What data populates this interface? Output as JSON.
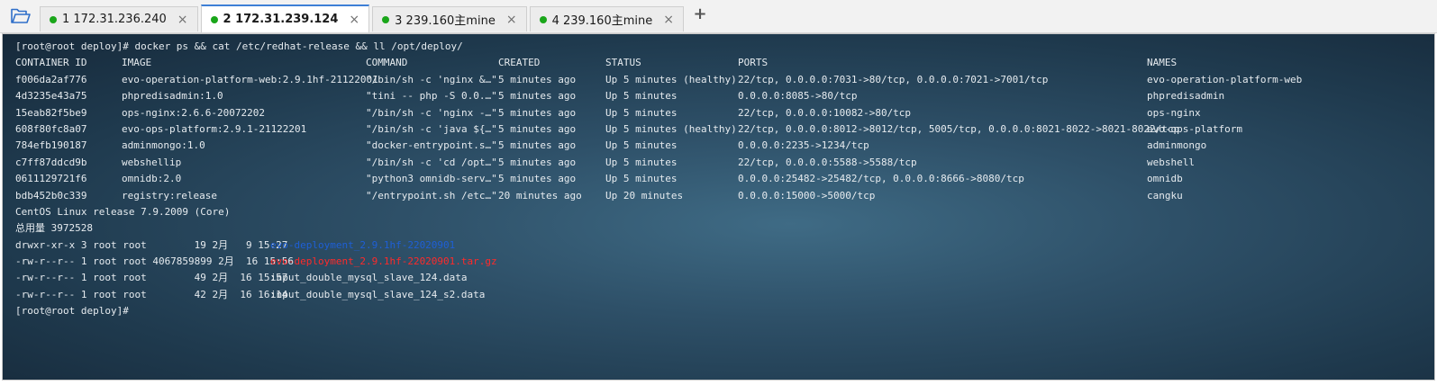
{
  "tabs": [
    {
      "label": "1 172.31.236.240",
      "active": false,
      "dot_color": "#1aa61a"
    },
    {
      "label": "2 172.31.239.124",
      "active": true,
      "dot_color": "#1aa61a"
    },
    {
      "label": "3 239.160主mine",
      "active": false,
      "dot_color": "#1aa61a"
    },
    {
      "label": "4 239.160主mine",
      "active": false,
      "dot_color": "#1aa61a"
    }
  ],
  "tab_close_glyph": "×",
  "add_tab_glyph": "+",
  "icons": {
    "folder": "folder-open-icon",
    "close": "close-icon",
    "add": "plus-icon"
  },
  "colors": {
    "accent": "#3d7fd6",
    "terminal_text": "#e6ebef",
    "dir_color": "#1e5fd6",
    "archive_color": "#ff2a2a"
  },
  "terminal": {
    "command": "[root@root deploy]# docker ps && cat /etc/redhat-release && ll /opt/deploy/",
    "headers": {
      "id": "CONTAINER ID",
      "image": "IMAGE",
      "command": "COMMAND",
      "created": "CREATED",
      "status": "STATUS",
      "ports": "PORTS",
      "names": "NAMES"
    },
    "containers": [
      {
        "id": "f006da2af776",
        "image": "evo-operation-platform-web:2.9.1hf-21122001",
        "command": "\"/bin/sh -c 'nginx &…\"",
        "created": "5 minutes ago",
        "status": "Up 5 minutes (healthy)",
        "ports": "22/tcp, 0.0.0.0:7031->80/tcp, 0.0.0.0:7021->7001/tcp",
        "names": "evo-operation-platform-web"
      },
      {
        "id": "4d3235e43a75",
        "image": "phpredisadmin:1.0",
        "command": "\"tini -- php -S 0.0.…\"",
        "created": "5 minutes ago",
        "status": "Up 5 minutes",
        "ports": "0.0.0.0:8085->80/tcp",
        "names": "phpredisadmin"
      },
      {
        "id": "15eab82f5be9",
        "image": "ops-nginx:2.6.6-20072202",
        "command": "\"/bin/sh -c 'nginx -…\"",
        "created": "5 minutes ago",
        "status": "Up 5 minutes",
        "ports": "22/tcp, 0.0.0.0:10082->80/tcp",
        "names": "ops-nginx"
      },
      {
        "id": "608f80fc8a07",
        "image": "evo-ops-platform:2.9.1-21122201",
        "command": "\"/bin/sh -c 'java ${…\"",
        "created": "5 minutes ago",
        "status": "Up 5 minutes (healthy)",
        "ports": "22/tcp, 0.0.0.0:8012->8012/tcp, 5005/tcp, 0.0.0.0:8021-8022->8021-8022/tcp",
        "names": "evo-ops-platform"
      },
      {
        "id": "784efb190187",
        "image": "adminmongo:1.0",
        "command": "\"docker-entrypoint.s…\"",
        "created": "5 minutes ago",
        "status": "Up 5 minutes",
        "ports": "0.0.0.0:2235->1234/tcp",
        "names": "adminmongo"
      },
      {
        "id": "c7ff87ddcd9b",
        "image": "webshellip",
        "command": "\"/bin/sh -c 'cd /opt…\"",
        "created": "5 minutes ago",
        "status": "Up 5 minutes",
        "ports": "22/tcp, 0.0.0.0:5588->5588/tcp",
        "names": "webshell"
      },
      {
        "id": "0611129721f6",
        "image": "omnidb:2.0",
        "command": "\"python3 omnidb-serv…\"",
        "created": "5 minutes ago",
        "status": "Up 5 minutes",
        "ports": "0.0.0.0:25482->25482/tcp, 0.0.0.0:8666->8080/tcp",
        "names": "omnidb"
      },
      {
        "id": "bdb452b0c339",
        "image": "registry:release",
        "command": "\"/entrypoint.sh /etc…\"",
        "created": "20 minutes ago",
        "status": "Up 20 minutes",
        "ports": "0.0.0.0:15000->5000/tcp",
        "names": "cangku"
      }
    ],
    "release": "CentOS Linux release 7.9.2009 (Core)",
    "total": "总用量 3972528",
    "files": [
      {
        "meta": "drwxr-xr-x 3 root root        19 2月   9 15:27",
        "name": "evo-deployment_2.9.1hf-22020901",
        "kind": "dir"
      },
      {
        "meta": "-rw-r--r-- 1 root root 4067859899 2月  16 15:56",
        "name": "evo-deployment_2.9.1hf-22020901.tar.gz",
        "kind": "archive"
      },
      {
        "meta": "-rw-r--r-- 1 root root        49 2月  16 15:57",
        "name": "input_double_mysql_slave_124.data",
        "kind": "file"
      },
      {
        "meta": "-rw-r--r-- 1 root root        42 2月  16 16:14",
        "name": "input_double_mysql_slave_124_s2.data",
        "kind": "file"
      }
    ],
    "prompt": "[root@root deploy]#"
  }
}
